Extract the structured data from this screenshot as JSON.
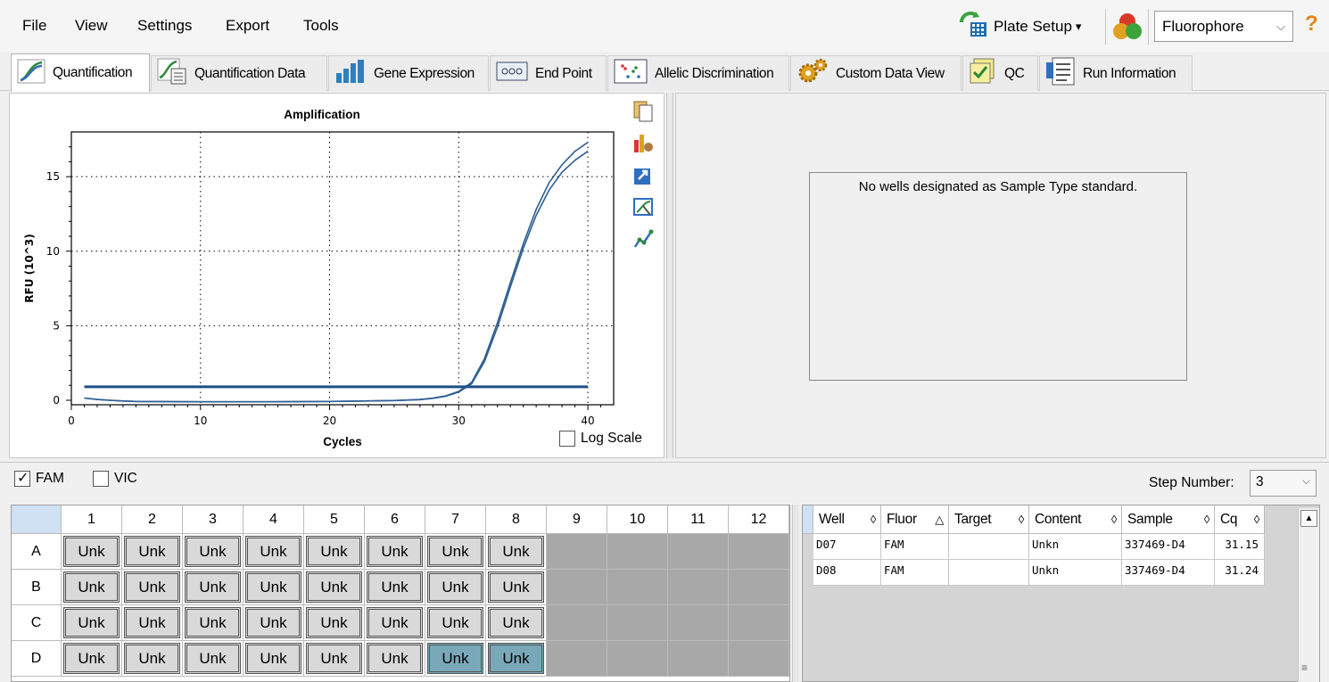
{
  "menu": [
    "File",
    "View",
    "Settings",
    "Export",
    "Tools"
  ],
  "toolbar": {
    "plate_setup": "Plate Setup",
    "plate_setup_arrow": "▾",
    "fluorophore": "Fluorophore",
    "select_arrow": "⌵",
    "help": "?"
  },
  "tabs": [
    "Quantification",
    "Quantification Data",
    "Gene Expression",
    "End Point",
    "Allelic Discrimination",
    "Custom Data View",
    "QC",
    "Run Information"
  ],
  "chart": {
    "title": "Amplification",
    "xlabel": "Cycles",
    "ylabel": "RFU (10^3)",
    "log_scale_label": "Log Scale"
  },
  "chart_data": {
    "type": "line",
    "title": "Amplification",
    "xlabel": "Cycles",
    "ylabel": "RFU (10^3)",
    "xlim": [
      0,
      42
    ],
    "ylim": [
      -0.3,
      18
    ],
    "xticks": [
      0,
      10,
      20,
      30,
      40
    ],
    "yticks": [
      0,
      5,
      10,
      15
    ],
    "grid": true,
    "series": [
      {
        "x": [
          1,
          2,
          3,
          4,
          5,
          10,
          15,
          20,
          25,
          27,
          28,
          29,
          30,
          31,
          32,
          33,
          34,
          35,
          36,
          37,
          38,
          39,
          40
        ],
        "values": [
          0.15,
          0.05,
          0.0,
          -0.05,
          -0.08,
          -0.1,
          -0.1,
          -0.08,
          -0.02,
          0.05,
          0.15,
          0.3,
          0.6,
          1.2,
          2.8,
          5.2,
          7.9,
          10.5,
          12.8,
          14.6,
          15.8,
          16.7,
          17.3
        ]
      },
      {
        "x": [
          1,
          2,
          3,
          4,
          5,
          10,
          15,
          20,
          25,
          27,
          28,
          29,
          30,
          31,
          32,
          33,
          34,
          35,
          36,
          37,
          38,
          39,
          40
        ],
        "values": [
          0.15,
          0.05,
          0.0,
          -0.05,
          -0.08,
          -0.1,
          -0.1,
          -0.08,
          -0.02,
          0.04,
          0.13,
          0.27,
          0.55,
          1.1,
          2.6,
          4.9,
          7.6,
          10.2,
          12.4,
          14.1,
          15.3,
          16.1,
          16.7
        ]
      },
      {
        "x": [
          1,
          40
        ],
        "values": [
          0.9,
          0.9
        ]
      }
    ]
  },
  "standard_msg": "No wells designated as Sample Type standard.",
  "fluors": [
    {
      "label": "FAM",
      "checked": true
    },
    {
      "label": "VIC",
      "checked": false
    }
  ],
  "step": {
    "label": "Step Number:",
    "value": "3",
    "arrow": "⌵"
  },
  "plate": {
    "cols": [
      "1",
      "2",
      "3",
      "4",
      "5",
      "6",
      "7",
      "8",
      "9",
      "10",
      "11",
      "12"
    ],
    "rows": [
      "A",
      "B",
      "C",
      "D"
    ],
    "well_label": "Unk",
    "filled_cols": 8,
    "selected": [
      "D7",
      "D8"
    ]
  },
  "results": {
    "headers": [
      {
        "label": "Well",
        "sort": "◊"
      },
      {
        "label": "Fluor",
        "sort": "△"
      },
      {
        "label": "Target",
        "sort": "◊"
      },
      {
        "label": "Content",
        "sort": "◊"
      },
      {
        "label": "Sample",
        "sort": "◊"
      },
      {
        "label": "Cq",
        "sort": "◊"
      }
    ],
    "rows": [
      {
        "well": "D07",
        "fluor": "FAM",
        "target": "",
        "content": "Unkn",
        "sample": "337469-D4",
        "cq": "31.15"
      },
      {
        "well": "D08",
        "fluor": "FAM",
        "target": "",
        "content": "Unkn",
        "sample": "337469-D4",
        "cq": "31.24"
      }
    ]
  },
  "colors": {
    "curve": "#2f5f93",
    "threshold": "#1f4f88",
    "selected_well": "#79a9b9",
    "empty_well": "#a8a8a8"
  }
}
